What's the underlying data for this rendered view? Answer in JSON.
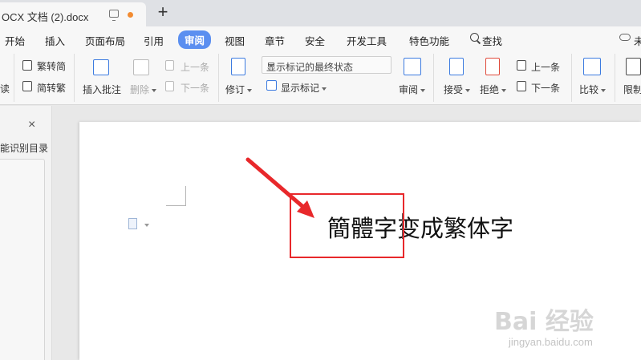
{
  "title_tab": {
    "title": "OCX 文档 (2).docx",
    "new_tab_symbol": "+"
  },
  "menubar": {
    "items": [
      "开始",
      "插入",
      "页面布局",
      "引用",
      "审阅",
      "视图",
      "章节",
      "安全",
      "开发工具",
      "特色功能"
    ],
    "active_index": 4,
    "search_label": "查找",
    "cloud_label": "未"
  },
  "toolbar": {
    "left_partial": "读",
    "trad_to_simp": "繁转简",
    "simp_to_trad": "简转繁",
    "insert_comment": "插入批注",
    "delete": "删除",
    "prev_comment": "上一条",
    "next_comment": "下一条",
    "revise": "修订",
    "markup_state": "显示标记的最终状态",
    "show_markup": "显示标记",
    "review": "审阅",
    "accept": "接受",
    "reject": "拒绝",
    "prev_change": "上一条",
    "next_change": "下一条",
    "compare": "比较",
    "restrict": "限制"
  },
  "sidebar": {
    "close_symbol": "×",
    "smart_toc": "能识别目录"
  },
  "document": {
    "text": "簡體字变成繁体字"
  },
  "watermark": {
    "main": "Bai 经验",
    "sub": "jingyan.baidu.com"
  },
  "colors": {
    "accent": "#5b8ff0",
    "highlight": "#e8282b",
    "unsaved": "#f28b31"
  }
}
